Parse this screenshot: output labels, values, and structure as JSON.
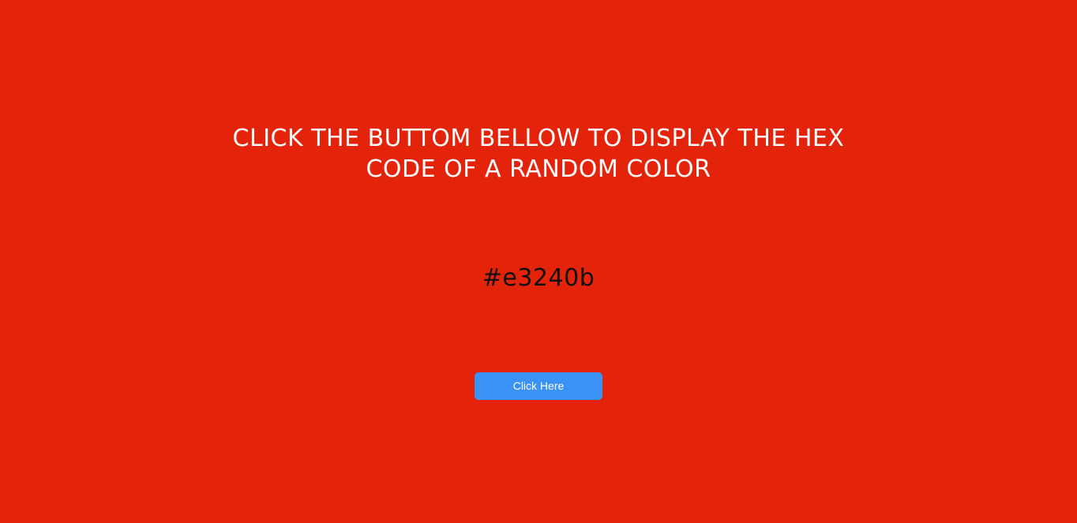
{
  "headline": {
    "line1": "CLICK THE BUTTOM BELLOW TO DISPLAY THE HEX",
    "line2": "CODE OF A RANDOM COLOR"
  },
  "hex_display": {
    "value": "#e3240b"
  },
  "button": {
    "label": "Click Here"
  },
  "colors": {
    "background": "#e3240b",
    "button": "#3b92f7",
    "headline_text": "#ffffff",
    "hex_text": "#111111"
  }
}
